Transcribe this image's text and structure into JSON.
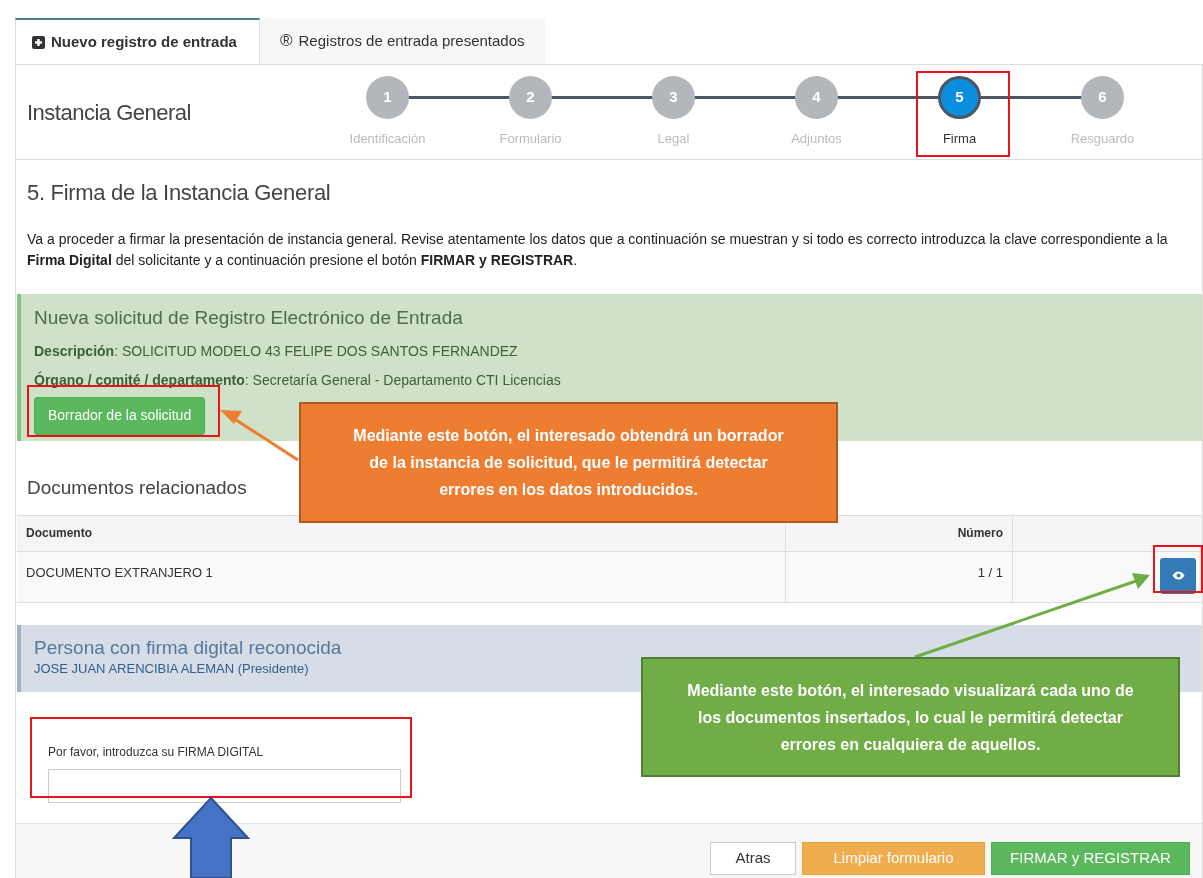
{
  "tabs": [
    {
      "kind": "new",
      "label": "Nuevo registro de entrada",
      "selected": true
    },
    {
      "kind": "list",
      "glyph": "®",
      "label": "Registros de entrada presentados",
      "selected": false
    }
  ],
  "header": {
    "title": "Instancia General"
  },
  "steps": [
    {
      "number": "1",
      "label": "Identificación",
      "selected": false
    },
    {
      "number": "2",
      "label": "Formulario",
      "selected": false
    },
    {
      "number": "3",
      "label": "Legal",
      "selected": false
    },
    {
      "number": "4",
      "label": "Adjuntos",
      "selected": false
    },
    {
      "number": "5",
      "label": "Firma",
      "selected": true
    },
    {
      "number": "6",
      "label": "Resguardo",
      "selected": false
    }
  ],
  "section": {
    "title": "5. Firma de la Instancia General",
    "intro": "Va a proceder a firmar la presentación de instancia general. Revise atentamente los datos que a continuación se muestran y si todo es correcto introduzca la clave correspondiente a la **Firma Digital** del solicitante y a continuación presione el botón **FIRMAR y REGISTRAR**."
  },
  "request_panel": {
    "title": "Nueva solicitud de Registro Electrónico de Entrada",
    "details": [
      "**Descripción**: SOLICITUD MODELO 43 FELIPE DOS SANTOS FERNANDEZ",
      "**Órgano / comité / departamento**: Secretaría General - Departamento CTI Licencias"
    ],
    "button": "Borrador de la solicitud"
  },
  "documents": {
    "title": "Documentos relacionados",
    "columns": [
      "Documento",
      "Número"
    ],
    "rows": [
      {
        "document": "DOCUMENTO EXTRANJERO 1",
        "number": "1 / 1"
      }
    ]
  },
  "signer_panel": {
    "title": "Persona con firma digital reconocida",
    "name": "JOSE JUAN ARENCIBIA ALEMAN (Presidente)"
  },
  "signature_field": {
    "label": "Por favor, introduzca su FIRMA DIGITAL"
  },
  "footer_buttons": [
    {
      "kind": "default",
      "label": "Atras"
    },
    {
      "kind": "warning",
      "label": "Limpiar formulario"
    },
    {
      "kind": "success",
      "label": "FIRMAR y REGISTRAR"
    }
  ],
  "annotations": [
    {
      "kind": "orange",
      "text": "Mediante este botón, el interesado obtendrá un borrador de la instancia de solicitud, que le permitirá detectar errores en los datos introducidos."
    },
    {
      "kind": "green",
      "text": "Mediante este botón, el interesado visualizará cada uno de los documentos insertados, lo cual le permitirá detectar errores en cualquiera de aquellos."
    }
  ]
}
